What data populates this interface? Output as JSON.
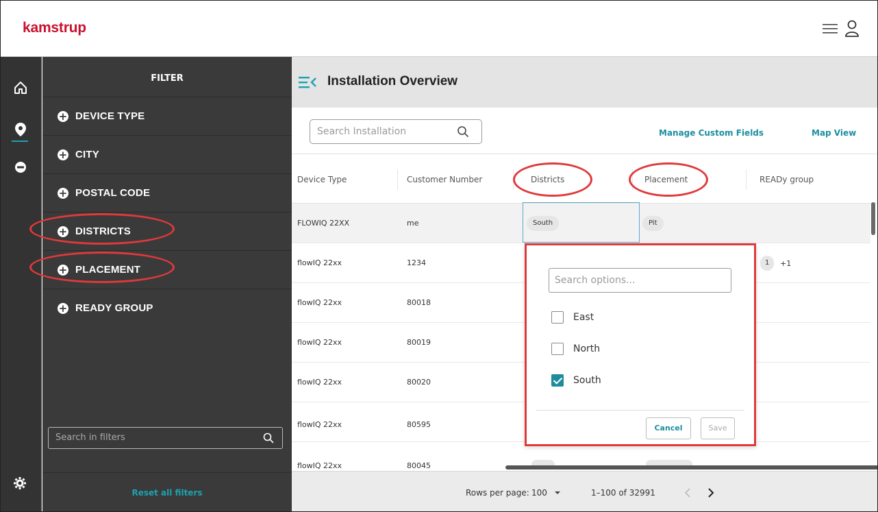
{
  "header": {
    "logo": "kamstrup",
    "icons": [
      "menu-icon",
      "user-icon"
    ]
  },
  "rail": {
    "icons": [
      "home-icon",
      "map-pin-icon",
      "meter-icon",
      "gear-icon"
    ]
  },
  "filter": {
    "title": "FILTER",
    "items": [
      {
        "label": "DEVICE TYPE"
      },
      {
        "label": "CITY"
      },
      {
        "label": "POSTAL CODE"
      },
      {
        "label": "DISTRICTS"
      },
      {
        "label": "PLACEMENT"
      },
      {
        "label": "READY GROUP"
      }
    ],
    "search_placeholder": "Search in filters",
    "reset_label": "Reset all filters"
  },
  "main": {
    "title": "Installation Overview",
    "search_placeholder": "Search Installation",
    "manage_custom_fields": "Manage Custom Fields",
    "map_view": "Map View",
    "columns": [
      "Device Type",
      "Customer Number",
      "Districts",
      "Placement",
      "READy group"
    ],
    "rows": [
      {
        "device_type": "FLOWIQ 22XX",
        "customer_number": "me",
        "district": "South",
        "placement": "Pit",
        "ready_group": ""
      },
      {
        "device_type": "flowIQ 22xx",
        "customer_number": "1234",
        "district": "",
        "placement": "",
        "ready_group": "1",
        "ready_group_more": "+1"
      },
      {
        "device_type": "flowIQ 22xx",
        "customer_number": "80018",
        "district": "",
        "placement": "",
        "ready_group": ""
      },
      {
        "device_type": "flowIQ 22xx",
        "customer_number": "80019",
        "district": "",
        "placement": "",
        "ready_group": ""
      },
      {
        "device_type": "flowIQ 22xx",
        "customer_number": "80020",
        "district": "",
        "placement": "",
        "ready_group": ""
      },
      {
        "device_type": "flowIQ 22xx",
        "customer_number": "80595",
        "district": "",
        "placement": "",
        "ready_group": ""
      },
      {
        "device_type": "flowIQ 22xx",
        "customer_number": "80045",
        "district": "",
        "placement": "",
        "ready_group": ""
      }
    ],
    "footer": {
      "rows_per_page_label": "Rows per page:",
      "rows_per_page_value": "100",
      "range": "1–100 of 32991"
    }
  },
  "popup": {
    "search_placeholder": "Search options...",
    "options": [
      {
        "label": "East",
        "checked": false
      },
      {
        "label": "North",
        "checked": false
      },
      {
        "label": "South",
        "checked": true
      }
    ],
    "cancel_label": "Cancel",
    "save_label": "Save"
  },
  "colors": {
    "brand": "#c8102e",
    "accent": "#1ba3b0",
    "annotation": "#e0393b",
    "panel": "#3a3a3a"
  }
}
